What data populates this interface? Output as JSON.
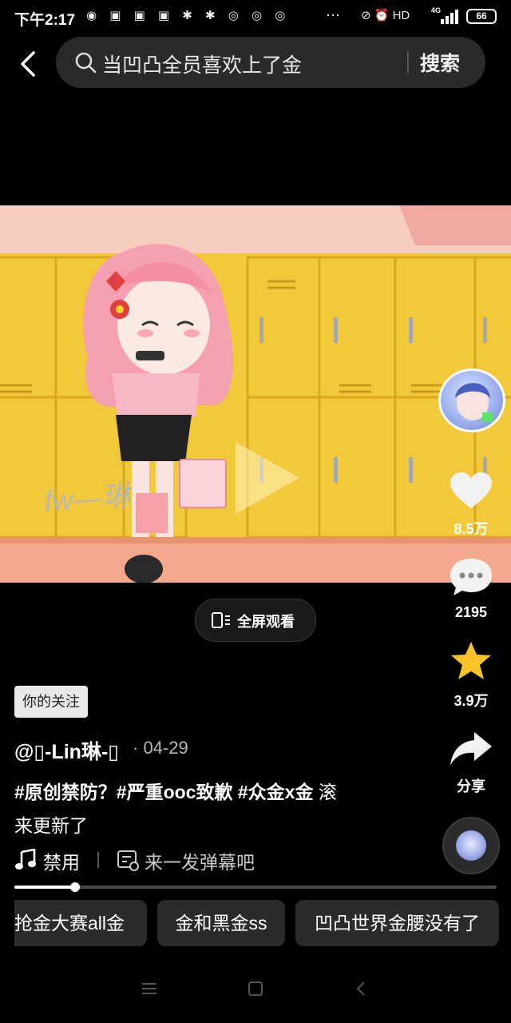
{
  "status_bar": {
    "time": "下午2:17",
    "left_icons": "◉ ▣ ▣ ▣ ✱ ✱ ◎ ◎ ◎",
    "dots": "···",
    "right_icons": "⊘ ⏰ HD",
    "network": "4G",
    "battery": "66"
  },
  "search": {
    "query": "当凹凸全员喜欢上了金",
    "button_label": "搜索"
  },
  "video": {
    "watermark": "fw—琳"
  },
  "fullscreen": {
    "label": "全屏观看"
  },
  "rail": {
    "likes": "8.5万",
    "comments": "2195",
    "favorites": "3.9万",
    "share_label": "分享"
  },
  "post": {
    "follow_tag": "你的关注",
    "author": "@▯-Lin琳-▯",
    "date": "· 04-29",
    "tags": "#原创禁防？#严重ooc致歉 #众金x金",
    "desc_tail": " 滚",
    "desc_line2": "来更新了",
    "music_label": "禁用",
    "danmu_placeholder": "来一发弹幕吧"
  },
  "progress": {
    "fraction": 0.125
  },
  "related_searches": [
    {
      "label": "抢金大赛all金"
    },
    {
      "label": "金和黑金ss"
    },
    {
      "label": "凹凸世界金腰没有了"
    }
  ],
  "colors": {
    "background": "#000000",
    "locker_yellow": "#f3c93c",
    "star_gold": "#f8c22b",
    "chip_bg": "#2b2b2b"
  }
}
